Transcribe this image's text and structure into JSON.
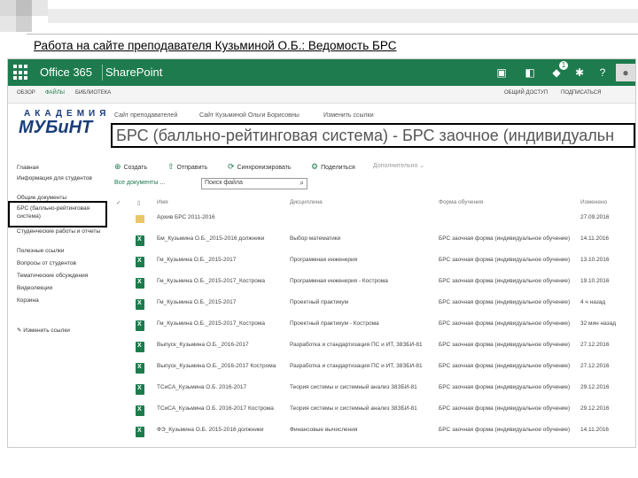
{
  "slide": {
    "title": "Работа на сайте преподавателя Кузьминой О.Б.: Ведомость БРС"
  },
  "topbar": {
    "brand": "Office 365",
    "suite": "SharePoint",
    "notifications_count": "1",
    "bg_color": "#1d7b4d"
  },
  "ribbon": {
    "tabs": [
      "Обзор",
      "Файлы",
      "Библиотека"
    ],
    "actions": [
      "Общий доступ",
      "Подписаться"
    ]
  },
  "site": {
    "logo_top": "АКАДЕМИЯ",
    "logo_bottom": "МУБиНТ",
    "crumbs": [
      "Сайт преподавателей",
      "Сайт Кузьминой Ольги Борисовны",
      "Изменить ссылки"
    ],
    "page_title": "БРС (балльно-рейтинговая система) - БРС заочное (индивидуальн"
  },
  "leftnav": {
    "items": [
      "Главная",
      "Информация для студентов",
      "Общие документы",
      "БРС (балльно-рейтинговая система)",
      "Студенческие работы и отчеты",
      "Полезные ссылки",
      "Вопросы от студентов",
      "Тематические обсуждения",
      "Видеолекции",
      "Корзина"
    ],
    "edit_label": "Изменить ссылки"
  },
  "commands": [
    {
      "label": "Создать",
      "icon": "plus-icon"
    },
    {
      "label": "Отправить",
      "icon": "upload-icon"
    },
    {
      "label": "Синхронизировать",
      "icon": "sync-icon"
    },
    {
      "label": "Поделиться",
      "icon": "share-icon"
    },
    {
      "label": "Дополнительно",
      "icon": "chevron-down-icon"
    }
  ],
  "views": {
    "current": "Все документы",
    "more": "...",
    "search_placeholder": "Поиск файла"
  },
  "table": {
    "headers": [
      "Имя",
      "Дисциплина",
      "Форма обучения",
      "Изменено"
    ],
    "rows": [
      {
        "type": "folder",
        "name": "Архив БРС 2011-2016",
        "discipline": "",
        "form": "",
        "modified": "27.09.2016"
      },
      {
        "type": "xls",
        "name": "Бм_Кузьмина О.Б._2015-2016 должники",
        "discipline": "Выбор математики",
        "form": "БРС заочная форма (индивидуальное обучение)",
        "modified": "14.11.2016"
      },
      {
        "type": "xls",
        "name": "Гм_Кузьмина О.Б._2015-2017",
        "discipline": "Программная инженерия",
        "form": "БРС заочная форма (индивидуальное обучение)",
        "modified": "13.10.2016"
      },
      {
        "type": "xls",
        "name": "Гм_Кузьмина О.Б._2015-2017_Кострома",
        "discipline": "Программная инженерия - Кострома",
        "form": "БРС заочная форма (индивидуальное обучение)",
        "modified": "19.10.2016"
      },
      {
        "type": "xls",
        "name": "Гм_Кузьмина О.Б._2015-2017",
        "discipline": "Проектный практикум",
        "form": "БРС заочная форма (индивидуальное обучение)",
        "modified": "4 ч назад"
      },
      {
        "type": "xls",
        "name": "Гм_Кузьмина О.Б._2015-2017_Кострома",
        "discipline": "Проектный практикум - Кострома",
        "form": "БРС заочная форма (индивидуальное обучение)",
        "modified": "32 мин назад"
      },
      {
        "type": "xls",
        "name": "Выпуск_Кузьмина О.Б._2016-2017",
        "discipline": "Разработка и стандартизация ПС и ИТ, 38ЗБИ-81",
        "form": "БРС заочная форма (индивидуальное обучение)",
        "modified": "27.12.2016"
      },
      {
        "type": "xls",
        "name": "Выпуск_Кузьмина О.Б._2016-2017 Кострома",
        "discipline": "Разработка и стандартизация ПС и ИТ, 38ЗБИ-81",
        "form": "БРС заочная форма (индивидуальное обучение)",
        "modified": "27.12.2016"
      },
      {
        "type": "xls",
        "name": "ТСиСА_Кузьмина О.Б. 2016-2017",
        "discipline": "Теория системы и системный анализ 38ЗБИ-81",
        "form": "БРС заочная форма (индивидуальное обучение)",
        "modified": "29.12.2016"
      },
      {
        "type": "xls",
        "name": "ТСиСА_Кузьмина О.Б. 2016-2017 Кострома",
        "discipline": "Теория системы и системный анализ 38ЗБИ-81",
        "form": "БРС заочная форма (индивидуальное обучение)",
        "modified": "29.12.2016"
      },
      {
        "type": "xls",
        "name": "ФЭ_Кузьмина О.Б. 2015-2016 должники",
        "discipline": "Финансовые вычисления",
        "form": "БРС заочная форма (индивидуальное обучение)",
        "modified": "14.11.2016"
      }
    ]
  }
}
